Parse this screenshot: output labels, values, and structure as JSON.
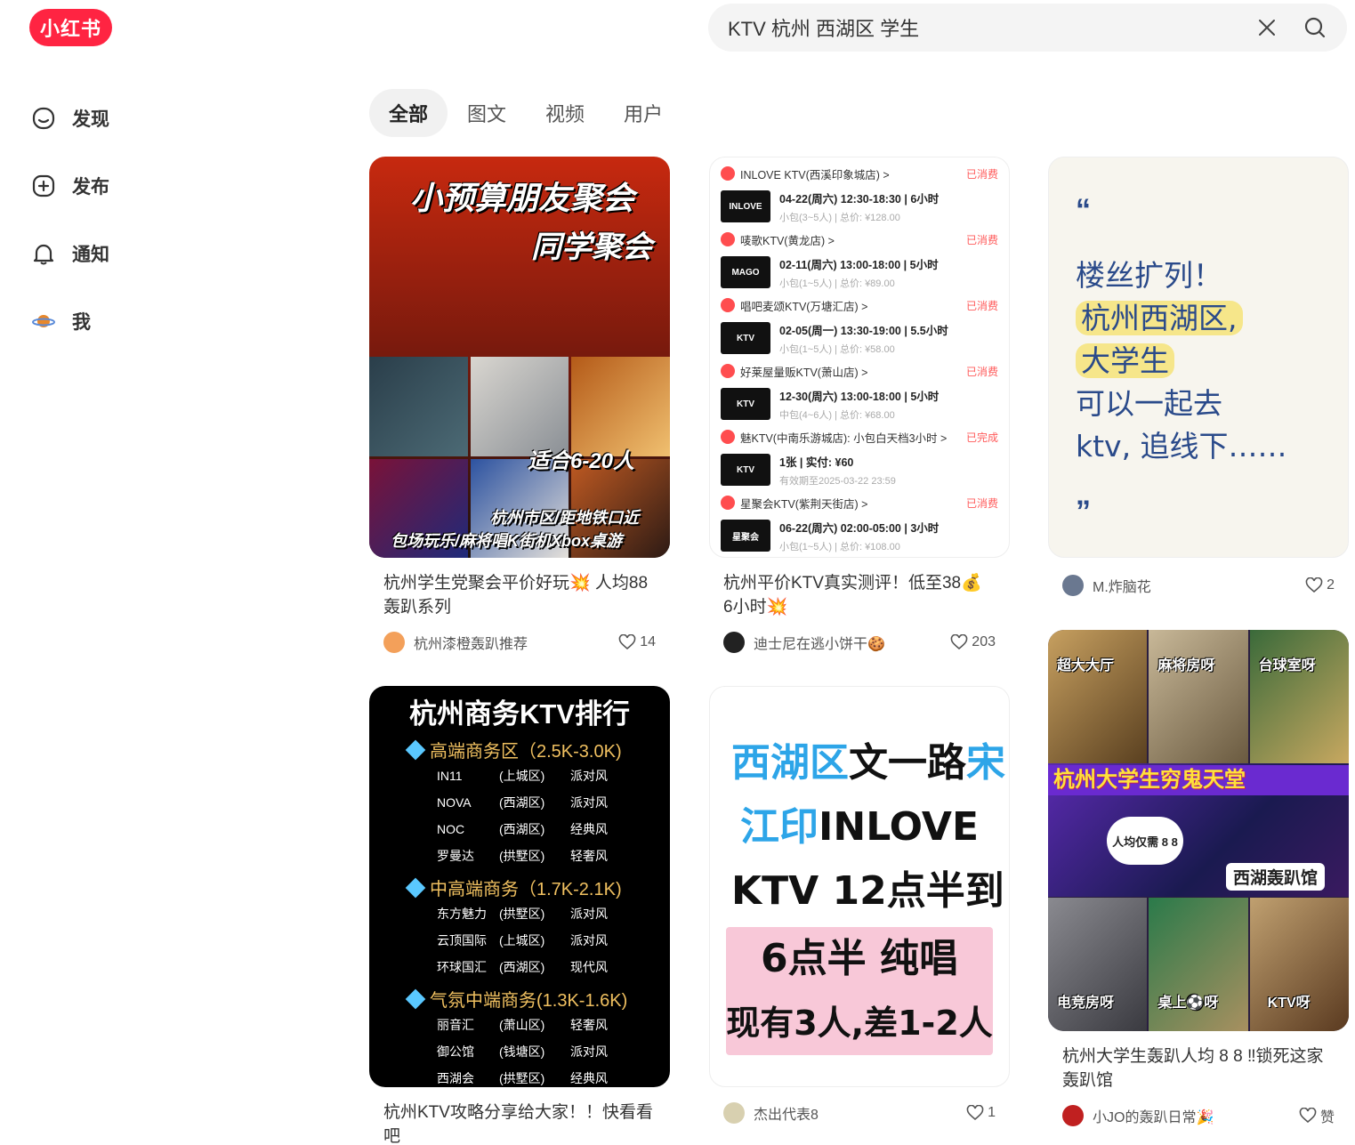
{
  "logo": "小红书",
  "search": {
    "value": "KTV 杭州 西湖区 学生"
  },
  "sidebar": {
    "items": [
      {
        "label": "发现",
        "icon": "discover-icon"
      },
      {
        "label": "发布",
        "icon": "plus-square-icon"
      },
      {
        "label": "通知",
        "icon": "bell-icon"
      },
      {
        "label": "我",
        "icon": "avatar-planet-icon"
      }
    ]
  },
  "tabs": [
    {
      "label": "全部",
      "active": true
    },
    {
      "label": "图文",
      "active": false
    },
    {
      "label": "视频",
      "active": false
    },
    {
      "label": "用户",
      "active": false
    }
  ],
  "cards": [
    {
      "title": "杭州学生党聚会平价好玩💥 人均88轰趴系列",
      "author": "杭州漆橙轰趴推荐",
      "likes": "14",
      "cover": {
        "line1": "小预算朋友聚会",
        "line2": "同学聚会",
        "line3": "适合6-20人",
        "line4": "杭州市区/距地铁口近",
        "line5": "包场玩乐/麻将唱K街机Xbox桌游"
      }
    },
    {
      "title": "杭州平价KTV真实测评！低至38💰 6小时💥",
      "author": "迪士尼在逃小饼干🍪",
      "likes": "203",
      "cover": {
        "orders": [
          {
            "store": "INLOVE KTV(西溪印象城店) >",
            "status": "已消费",
            "thumb": "INLOVE",
            "line1": "04-22(周六) 12:30-18:30 | 6小时",
            "line2": "小包(3~5人) | 总价: ¥128.00"
          },
          {
            "store": "唛歌KTV(黄龙店) >",
            "status": "已消费",
            "thumb": "MAGO",
            "line1": "02-11(周六) 13:00-18:00 | 5小时",
            "line2": "小包(1~5人) | 总价: ¥89.00"
          },
          {
            "store": "唱吧麦颂KTV(万塘汇店) >",
            "status": "已消费",
            "thumb": "KTV",
            "line1": "02-05(周一) 13:30-19:00 | 5.5小时",
            "line2": "小包(1~5人) | 总价: ¥58.00"
          },
          {
            "store": "好莱屋量贩KTV(萧山店) >",
            "status": "已消费",
            "thumb": "KTV",
            "line1": "12-30(周六) 13:00-18:00 | 5小时",
            "line2": "中包(4~6人) | 总价: ¥68.00"
          },
          {
            "store": "魅KTV(中南乐游城店): 小包白天档3小时 >",
            "status": "已完成",
            "thumb": "KTV",
            "line1": "1张 | 实付: ¥60",
            "line2": "有效期至2025-03-22 23:59"
          },
          {
            "store": "星聚会KTV(紫荆天街店) >",
            "status": "已消费",
            "thumb": "星聚会",
            "line1": "06-22(周六) 02:00-05:00 | 3小时",
            "line2": "小包(1~5人) | 总价: ¥108.00"
          }
        ]
      }
    },
    {
      "title": "",
      "author": "M.炸脑花",
      "likes": "2",
      "cover": {
        "quote_open": "“",
        "quote_close": "”",
        "lines": [
          "楼丝扩列！",
          "杭州西湖区,",
          "大学生",
          "可以一起去",
          "ktv, 追线下……"
        ]
      }
    },
    {
      "title": "杭州KTV攻略分享给大家！！快看看吧",
      "author": "",
      "likes": "",
      "cover": {
        "head": "杭州商务KTV排行",
        "sections": [
          {
            "name": "高端商务区（2.5K-3.0K)",
            "rows": [
              [
                "IN11",
                "(上城区)",
                "派对风"
              ],
              [
                "NOVA",
                "(西湖区)",
                "派对风"
              ],
              [
                "NOC",
                "(西湖区)",
                "经典风"
              ],
              [
                "罗曼达",
                "(拱墅区)",
                "轻奢风"
              ]
            ]
          },
          {
            "name": "中高端商务（1.7K-2.1K)",
            "rows": [
              [
                "东方魅力",
                "(拱墅区)",
                "派对风"
              ],
              [
                "云顶国际",
                "(上城区)",
                "派对风"
              ],
              [
                "环球国汇",
                "(西湖区)",
                "现代风"
              ]
            ]
          },
          {
            "name": "气氛中端商务(1.3K-1.6K)",
            "rows": [
              [
                "丽音汇",
                "(萧山区)",
                "轻奢风"
              ],
              [
                "御公馆",
                "(钱塘区)",
                "派对风"
              ],
              [
                "西湖会",
                "(拱墅区)",
                "经典风"
              ]
            ]
          }
        ]
      }
    },
    {
      "title": "",
      "author": "杰出代表8",
      "likes": "1",
      "cover": {
        "l1a": "西湖区",
        "l1b": "文一路",
        "l1c": "宋",
        "l2a": "江印",
        "l2b": "INLOVE",
        "l3": "KTV  12点半到",
        "l4": "6点半  纯唱",
        "l5": "现有3人,差1-2人"
      }
    },
    {
      "title": "杭州大学生轰趴人均 8 8 ‼锁死这家轰趴馆",
      "author": "小JO的轰趴日常🎉",
      "likes": "赞",
      "cover": {
        "tags": [
          "超大大厅",
          "麻将房呀",
          "台球室呀",
          "电竞房呀",
          "桌上⚽呀",
          "KTV呀"
        ],
        "band": "杭州大学生穷鬼天堂",
        "badge": "人均仅需 8 8",
        "location": "西湖轰趴馆"
      }
    }
  ]
}
